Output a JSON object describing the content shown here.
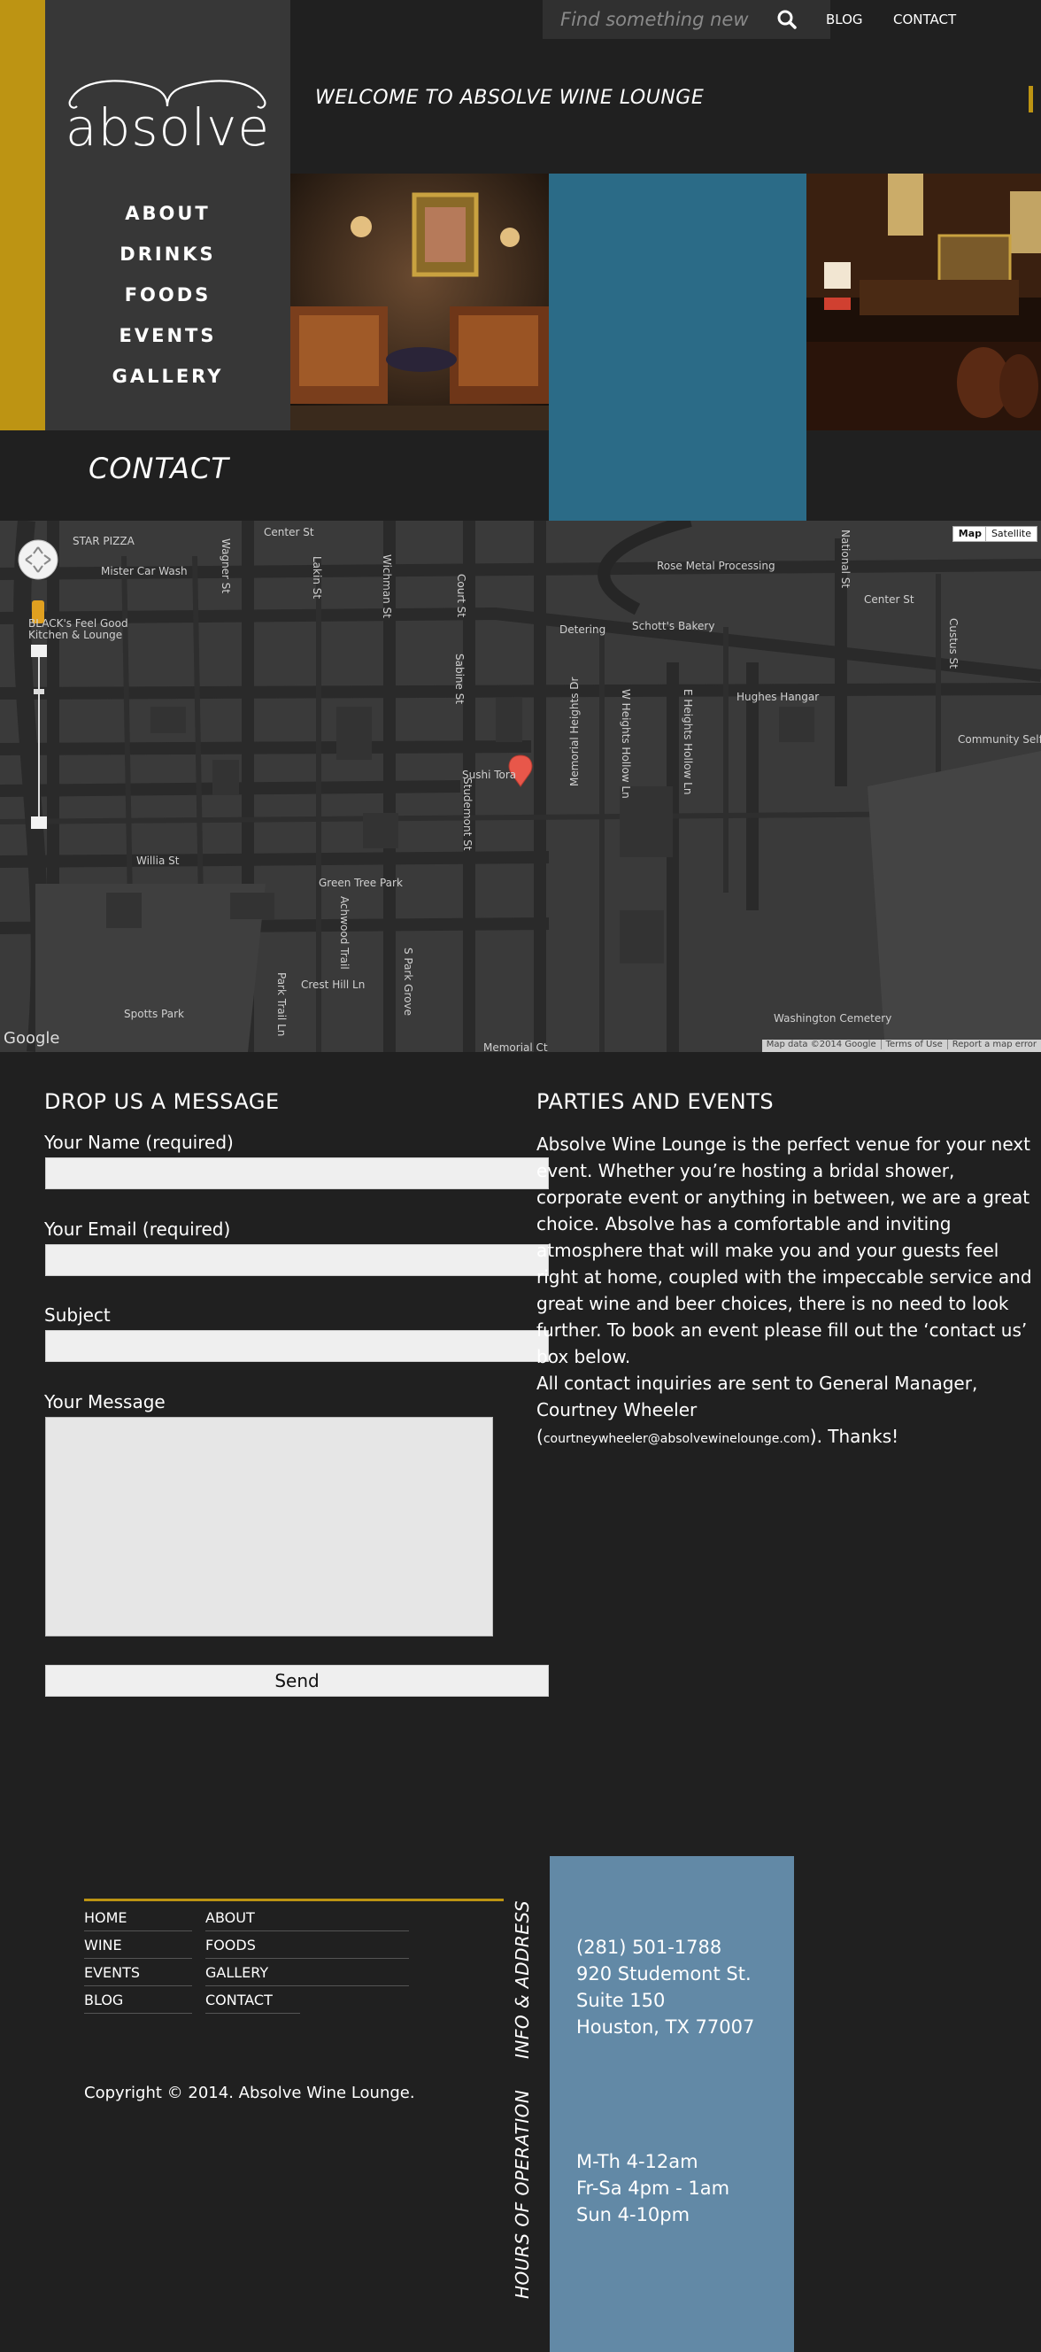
{
  "search": {
    "placeholder": "Find something new"
  },
  "top_nav": {
    "blog": "BLOG",
    "contact": "CONTACT"
  },
  "logo": {
    "text": "absolve"
  },
  "welcome": "WELCOME TO ABSOLVE WINE LOUNGE",
  "main_nav": [
    "ABOUT",
    "DRINKS",
    "FOODS",
    "EVENTS",
    "GALLERY"
  ],
  "page_title": "CONTACT",
  "map": {
    "buttons": {
      "map": "Map",
      "satellite": "Satellite"
    },
    "labels": [
      "Center St",
      "STAR PIZZA",
      "Mister Car Wash",
      "Wagner St",
      "Lakin St",
      "Wichman St",
      "Court St",
      "Rose Metal Processing",
      "National St",
      "Center St",
      "BLACK's Feel Good Kitchen & Lounge",
      "Detering",
      "Schott's Bakery",
      "Sabine St",
      "Hughes Hangar",
      "Custus St",
      "Community Self St",
      "W Heights Hollow Ln",
      "E Heights Hollow Ln",
      "Sushi Tora",
      "Memorial Heights Dr",
      "Studemont St",
      "Willia St",
      "Green Tree Park",
      "Achwood Trail",
      "S Park Grove",
      "Crest Hill Ln",
      "Park Trail Ln",
      "Spotts Park",
      "Washington Cemetery",
      "Memorial Ct",
      "Google"
    ],
    "footer": {
      "data": "Map data ©2014 Google",
      "terms": "Terms of Use",
      "report": "Report a map error"
    }
  },
  "form": {
    "title": "DROP US A MESSAGE",
    "name_label": "Your Name (required)",
    "email_label": "Your Email (required)",
    "subject_label": "Subject",
    "message_label": "Your Message",
    "send": "Send"
  },
  "parties": {
    "title": "PARTIES AND EVENTS",
    "body": "Absolve Wine Lounge is the perfect venue for your next event. Whether you’re hosting a bridal shower, corporate event or anything in between, we are a great choice. Absolve has a comfortable and inviting atmosphere that will make you and your guests feel right at home, coupled with the impeccable service and great wine and beer choices, there is no need to look further. To book an event please fill out the ‘contact us’ box below.",
    "contact_prefix": "All contact inquiries are sent to General Manager, Courtney Wheeler",
    "email": "courtneywheeler@absolvewinelounge.com",
    "contact_suffix": "). Thanks!"
  },
  "footer": {
    "links": [
      "HOME",
      "ABOUT",
      "WINE",
      "FOODS",
      "EVENTS",
      "GALLERY",
      "BLOG",
      "CONTACT"
    ],
    "copyright": "Copyright © 2014. Absolve Wine Lounge.",
    "info_title": "INFO & ADDRESS",
    "hours_title": "HOURS OF OPERATION",
    "phone": "(281) 501-1788",
    "address": [
      "920 Studemont St.",
      "Suite 150",
      "Houston, TX 77007"
    ],
    "hours": [
      "M-Th 4-12am",
      "Fr-Sa 4pm - 1am",
      "Sun 4-10pm"
    ]
  },
  "colors": {
    "gold": "#bd9413",
    "teal": "#2b6b87",
    "steel": "#6289a6",
    "bg": "#202020",
    "panel": "#373737"
  }
}
